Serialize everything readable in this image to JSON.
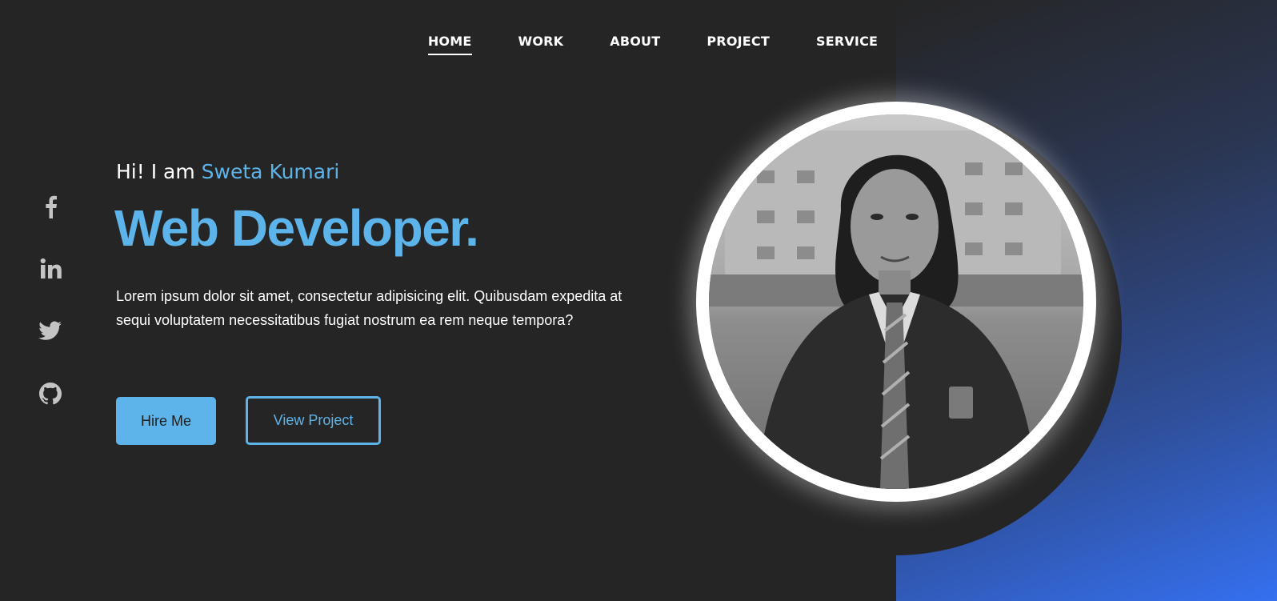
{
  "nav": {
    "items": [
      {
        "label": "HOME",
        "active": true
      },
      {
        "label": "WORK",
        "active": false
      },
      {
        "label": "ABOUT",
        "active": false
      },
      {
        "label": "PROJECT",
        "active": false
      },
      {
        "label": "SERVICE",
        "active": false
      }
    ]
  },
  "social": {
    "icons": [
      "facebook-icon",
      "linkedin-icon",
      "twitter-icon",
      "github-icon"
    ]
  },
  "hero": {
    "greeting": "Hi! I am",
    "name": "Sweta Kumari",
    "role": "Web Developer.",
    "description": "Lorem ipsum dolor sit amet, consectetur adipisicing elit. Quibusdam expedita at sequi voluptatem necessitatibus fugiat nostrum ea rem neque tempora?",
    "hire_label": "Hire Me",
    "project_label": "View Project"
  },
  "portrait": {
    "alt": "profile-photo"
  },
  "colors": {
    "background": "#252525",
    "accent": "#5db4ea",
    "gradient_end": "#3570f0"
  }
}
